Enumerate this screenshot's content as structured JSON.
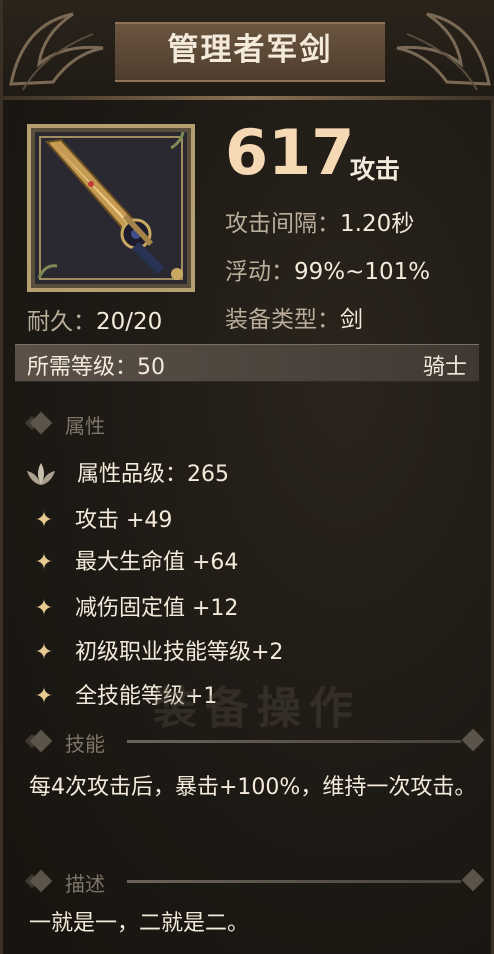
{
  "item": {
    "name": "管理者军剑",
    "attack_value": "617",
    "attack_label": "攻击",
    "attack_interval_label": "攻击间隔：",
    "attack_interval_value": "1.20秒",
    "float_label": "浮动：",
    "float_value": "99%~101%",
    "type_label": "装备类型：",
    "type_value": "剑",
    "durability_label": "耐久：",
    "durability_value": "20/20",
    "required_level_label": "所需等级：",
    "required_level_value": "50",
    "class": "骑士",
    "icon": "sword-icon"
  },
  "sections": {
    "attributes": "属性",
    "skill": "技能",
    "description": "描述"
  },
  "attributes": {
    "grade_label": "属性品级：",
    "grade_value": "265",
    "lines": [
      "攻击 +49",
      "最大生命值 +64",
      "减伤固定值 +12",
      "初级职业技能等级+2",
      "全技能等级+1"
    ]
  },
  "skill_text": "每4次攻击后，暴击+100%，维持一次攻击。",
  "description_text": "一就是一，二就是二。",
  "background_watermark": "装备操作",
  "colors": {
    "accent": "#f5d9b4",
    "star": "#e7c992",
    "panel": "#1e1a15"
  }
}
